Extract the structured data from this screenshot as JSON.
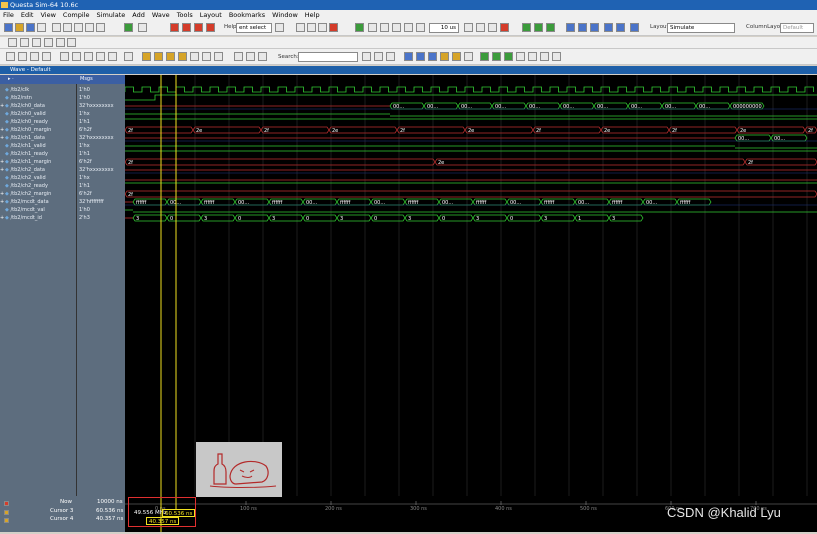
{
  "app": {
    "title": "Questa Sim-64 10.6c"
  },
  "menu": [
    "File",
    "Edit",
    "View",
    "Compile",
    "Simulate",
    "Add",
    "Wave",
    "Tools",
    "Layout",
    "Bookmarks",
    "Window",
    "Help"
  ],
  "toolbar": {
    "help_label": "Help",
    "help_value": "ent select",
    "run_length": "10 us",
    "layout_label": "Layout",
    "layout_value": "Simulate",
    "column_layout_label": "ColumnLayout",
    "column_layout_value": "Default",
    "search_label": "Search:"
  },
  "wave": {
    "title": "Wave - Default",
    "header_name": "Msgs",
    "colors": {
      "bg": "#000000",
      "signal": "#33cc33",
      "cursor": "#f0e020",
      "grid": "#2e2e2e"
    }
  },
  "signals": [
    {
      "name": "/tb2/clk",
      "value": "1'h0",
      "expand": false
    },
    {
      "name": "/tb2/rstn",
      "value": "1'h0",
      "expand": false
    },
    {
      "name": "/tb2/ch0_data",
      "value": "32'hxxxxxxxx",
      "expand": true
    },
    {
      "name": "/tb2/ch0_valid",
      "value": "1'hx",
      "expand": false
    },
    {
      "name": "/tb2/ch0_ready",
      "value": "1'h1",
      "expand": false
    },
    {
      "name": "/tb2/ch0_margin",
      "value": "6'h2f",
      "expand": true
    },
    {
      "name": "/tb2/ch1_data",
      "value": "32'hxxxxxxxx",
      "expand": true
    },
    {
      "name": "/tb2/ch1_valid",
      "value": "1'hx",
      "expand": false
    },
    {
      "name": "/tb2/ch1_ready",
      "value": "1'h1",
      "expand": false
    },
    {
      "name": "/tb2/ch1_margin",
      "value": "6'h2f",
      "expand": true
    },
    {
      "name": "/tb2/ch2_data",
      "value": "32'hxxxxxxxx",
      "expand": true
    },
    {
      "name": "/tb2/ch2_valid",
      "value": "1'hx",
      "expand": false
    },
    {
      "name": "/tb2/ch2_ready",
      "value": "1'h1",
      "expand": false
    },
    {
      "name": "/tb2/ch2_margin",
      "value": "6'h2f",
      "expand": true
    },
    {
      "name": "/tb2/mcdt_data",
      "value": "32'hffffffff",
      "expand": true
    },
    {
      "name": "/tb2/mcdt_val",
      "value": "1'h0",
      "expand": false
    },
    {
      "name": "/tb2/mcdt_id",
      "value": "2'h3",
      "expand": true
    }
  ],
  "wave_labels": {
    "ch0_data": [
      "00...",
      "00...",
      "00...",
      "00...",
      "00...",
      "00...",
      "00...",
      "00...",
      "00...",
      "00...",
      "000000000"
    ],
    "ch0_margin": [
      "2f",
      "2e",
      "2f",
      "2e",
      "2f",
      "2e",
      "2f",
      "2e",
      "2f",
      "2e",
      "2f"
    ],
    "ch1_data": [
      "00...",
      "00..."
    ],
    "ch1_margin": [
      "2f",
      "2e",
      "2f"
    ],
    "ch2_margin": [
      "2f"
    ],
    "mcdt_data": [
      "ffffff",
      "00...",
      "ffffff",
      "00...",
      "ffffff",
      "00...",
      "ffffff",
      "00...",
      "ffffff",
      "00...",
      "ffffff",
      "00...",
      "ffffff",
      "00...",
      "ffffff",
      "00...",
      "ffffff"
    ],
    "mcdt_id": [
      "3",
      "0",
      "3",
      "0",
      "3",
      "0",
      "3",
      "0",
      "3",
      "0",
      "3",
      "0",
      "3",
      "1",
      "3"
    ]
  },
  "timeline": {
    "ticks": [
      "0 ns",
      "100 ns",
      "200 ns",
      "300 ns",
      "400 ns",
      "500 ns",
      "600 ns",
      "700 ns"
    ]
  },
  "cursors": {
    "now_label": "Now",
    "now_value": "10000 ns",
    "cursor3_label": "Cursor 3",
    "cursor3_value": "60.536 ns",
    "cursor3_flag": "60.536 ns",
    "cursor4_label": "Cursor 4",
    "cursor4_value": "40.357 ns",
    "cursor4_flag": "40.357 ns",
    "delta": "49.556 MHz"
  },
  "watermark": "CSDN @Khalid Lyu"
}
